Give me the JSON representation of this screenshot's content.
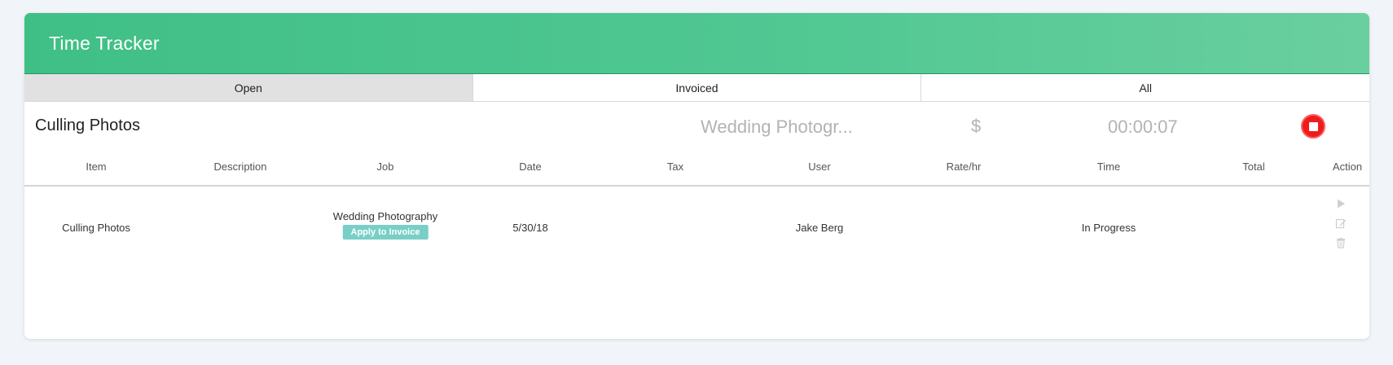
{
  "header": {
    "title": "Time Tracker"
  },
  "tabs": [
    {
      "label": "Open",
      "active": true
    },
    {
      "label": "Invoiced",
      "active": false
    },
    {
      "label": "All",
      "active": false
    }
  ],
  "timer": {
    "item": "Culling Photos",
    "job": "Wedding Photogr...",
    "currency": "$",
    "elapsed": "00:00:07",
    "stop_icon": "stop-icon",
    "stop_color": "#ee1c1c"
  },
  "table": {
    "columns": [
      "Item",
      "Description",
      "Job",
      "Date",
      "Tax",
      "User",
      "Rate/hr",
      "Time",
      "Total",
      "Action"
    ],
    "rows": [
      {
        "item": "Culling Photos",
        "description": "",
        "job": "Wedding Photography",
        "apply_label": "Apply to Invoice",
        "date": "5/30/18",
        "tax": "",
        "user": "Jake Berg",
        "rate": "",
        "time": "In Progress",
        "total": "",
        "actions": [
          "play-icon",
          "edit-icon",
          "trash-icon"
        ]
      }
    ]
  },
  "colors": {
    "header_green": "#4cc58e",
    "apply_button": "#79cfc7",
    "muted_text": "#b3b3b3",
    "active_tab": "#e1e1e1"
  }
}
